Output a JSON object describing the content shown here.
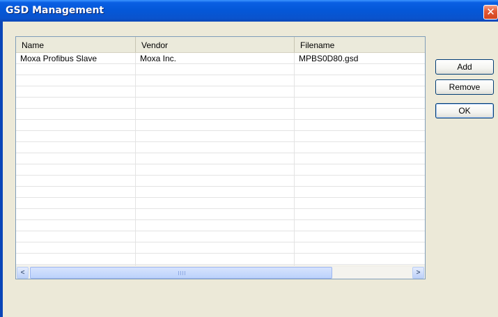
{
  "window": {
    "title": "GSD Management",
    "close_label": "✕"
  },
  "list": {
    "columns": [
      "Name",
      "Vendor",
      "Filename"
    ],
    "rows": [
      {
        "name": "Moxa Profibus Slave",
        "vendor": "Moxa Inc.",
        "filename": "MPBS0D80.gsd"
      }
    ]
  },
  "buttons": {
    "add": "Add",
    "remove": "Remove",
    "ok": "OK"
  },
  "scrollbar": {
    "left_arrow": "<",
    "right_arrow": ">"
  },
  "colors": {
    "titlebar": "#0458d9",
    "dialog_bg": "#ece9d8",
    "close": "#e35a36"
  }
}
